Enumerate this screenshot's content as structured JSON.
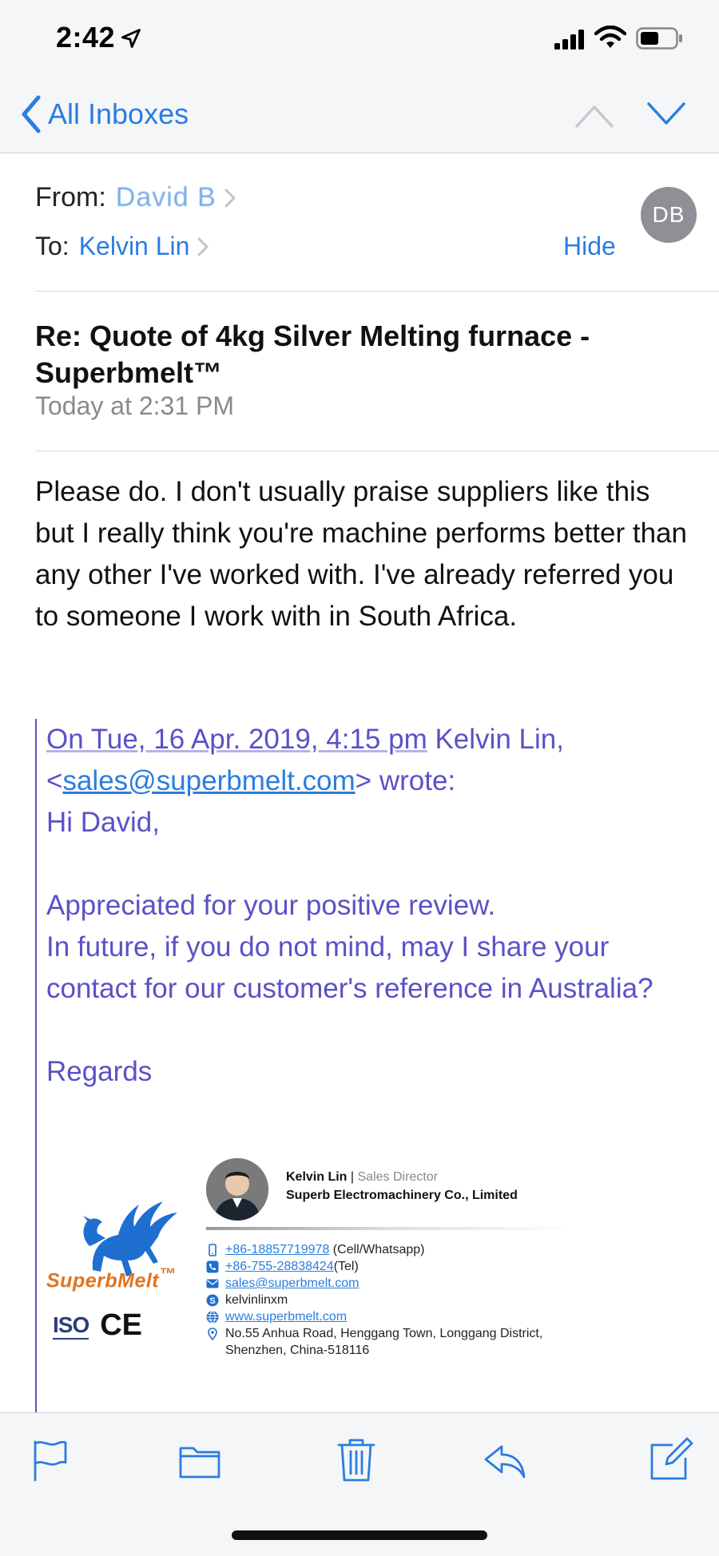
{
  "status_bar": {
    "time": "2:42"
  },
  "nav": {
    "back_label": "All Inboxes"
  },
  "header": {
    "from_label": "From:",
    "from_value": "David B",
    "to_label": "To:",
    "to_value": "Kelvin Lin",
    "hide_label": "Hide",
    "avatar_initials": "DB"
  },
  "subject": "Re: Quote of 4kg Silver Melting furnace - Superbmelt™",
  "date": "Today at 2:31 PM",
  "body": "Please do. I don't usually praise suppliers like this but I really think you're machine performs better than any other I've worked with. I've already referred you to someone I work with in South Africa.",
  "quote": {
    "attribution_date": "On Tue, 16 Apr. 2019, 4:15 pm",
    "attribution_name": " Kelvin Lin,",
    "email_open": "<",
    "email": "sales@superbmelt.com",
    "email_close": "> wrote:",
    "greeting": "Hi David,",
    "line1": "Appreciated for your positive review.",
    "line2": "In future, if you do not mind, may I share your contact for our customer's reference in Australia?",
    "regards": "Regards"
  },
  "signature": {
    "brand": "SuperbMelt",
    "brand_mark": "™",
    "iso": "ISO",
    "ce": "CE",
    "name": "Kelvin Lin",
    "sep": " | ",
    "role": "Sales Director",
    "company": "Superb Electromachinery Co., Limited",
    "phone1": "+86-18857719978",
    "phone1_note": " (Cell/Whatsapp)",
    "phone2": "+86-755-28838424",
    "phone2_note": "(Tel)",
    "email": "sales@superbmelt.com",
    "skype": "kelvinlinxm",
    "website": "www.superbmelt.com",
    "address": "No.55 Anhua Road, Henggang Town, Longgang District, Shenzhen, China-518116"
  },
  "colors": {
    "accent": "#2b7de0",
    "quote": "#5a52c6",
    "brand_orange": "#e07420",
    "brand_blue": "#1f6fd0"
  }
}
